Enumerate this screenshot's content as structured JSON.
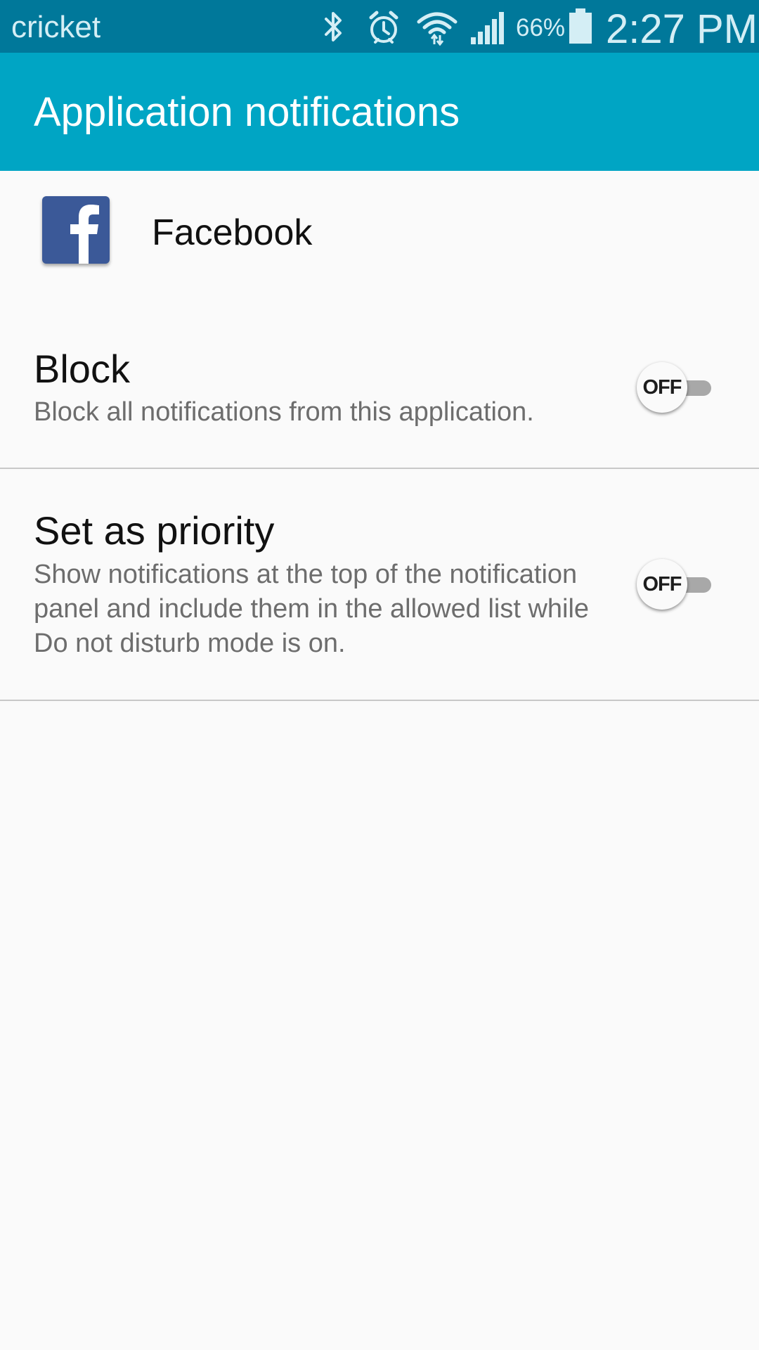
{
  "status_bar": {
    "carrier": "cricket",
    "battery_percent": "66%",
    "time": "2:27 PM",
    "icons": [
      "bluetooth-icon",
      "alarm-icon",
      "wifi-icon",
      "signal-icon",
      "battery-icon"
    ]
  },
  "app_bar": {
    "title": "Application notifications",
    "color": "#00a5c4"
  },
  "app": {
    "name": "Facebook",
    "icon": "facebook-icon",
    "icon_color": "#3b5998"
  },
  "settings": [
    {
      "title": "Block",
      "description": "Block all notifications from this application.",
      "switch_label": "OFF"
    },
    {
      "title": "Set as priority",
      "description": "Show notifications at the top of the notification panel and include them in the allowed list while Do not disturb mode is on.",
      "switch_label": "OFF"
    }
  ]
}
